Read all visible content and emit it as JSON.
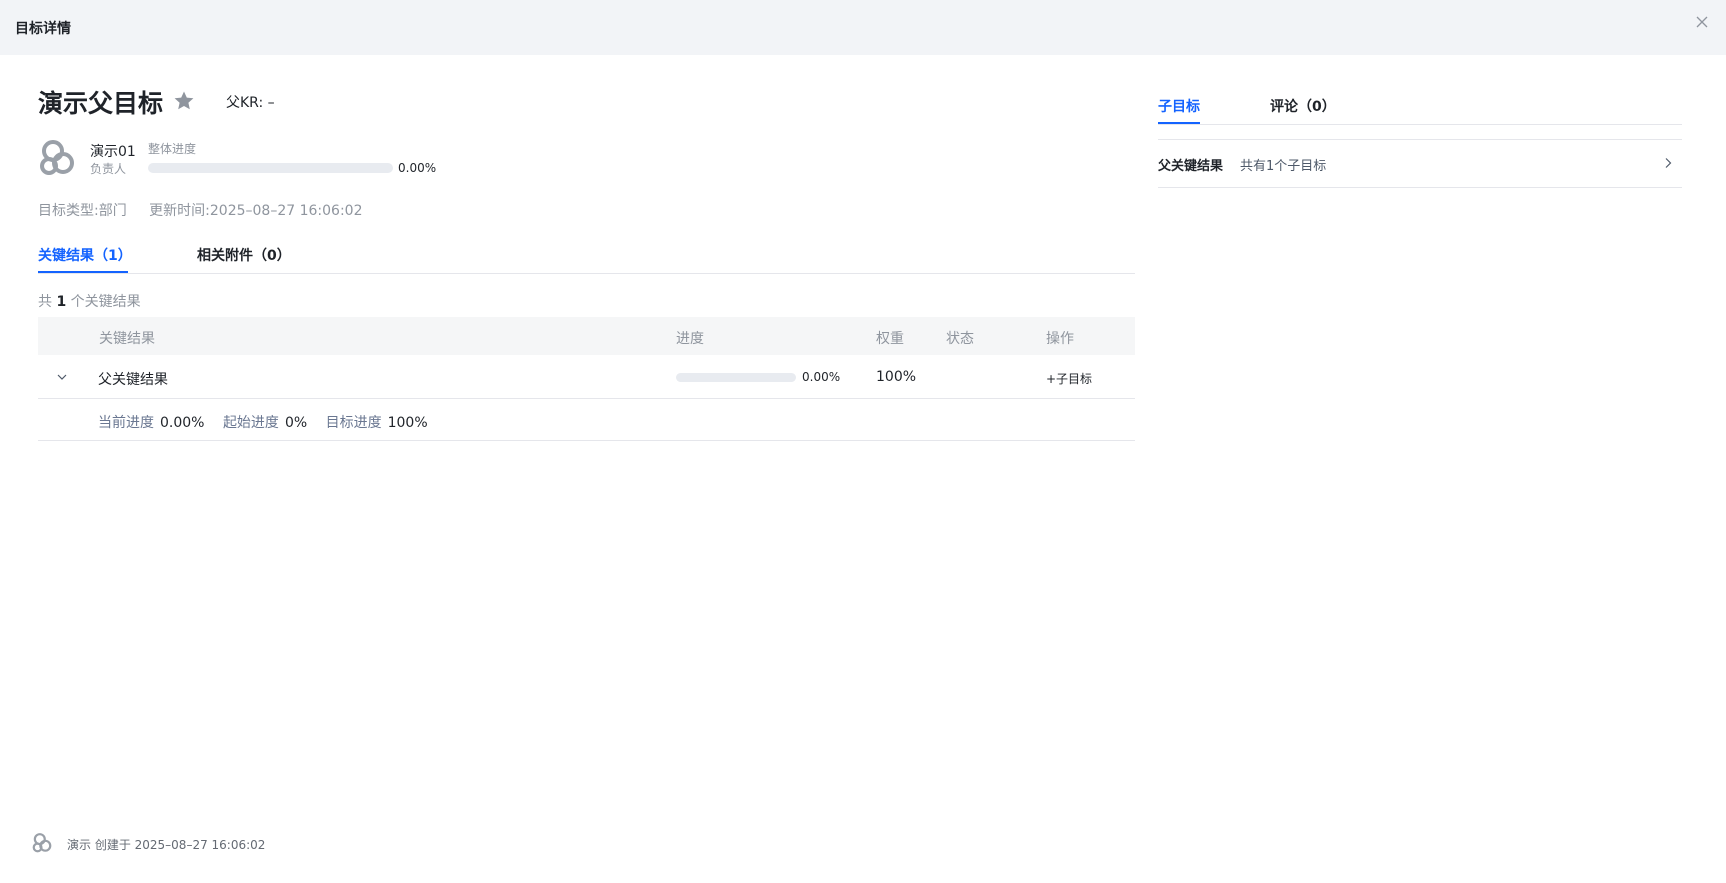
{
  "header": {
    "title": "目标详情",
    "close_icon": "close-icon"
  },
  "objective": {
    "title": "演示父目标",
    "star_icon": "star-icon",
    "parent_kr_label": "父KR:",
    "parent_kr_value": "–",
    "owner": {
      "name": "演示01",
      "role": "负责人",
      "avatar_icon": "user-avatar-icon"
    },
    "overall_progress": {
      "label": "整体进度",
      "value": 0.0,
      "display": "0.00%"
    },
    "type_label": "目标类型:",
    "type_value": "部门",
    "updated_label": "更新时间:",
    "updated_value": "2025–08–27 16:06:02"
  },
  "tabs": {
    "kr": "关键结果（1）",
    "attachments": "相关附件（0）"
  },
  "kr_summary": {
    "prefix": "共",
    "count": "1",
    "suffix": "个关键结果"
  },
  "table": {
    "headers": {
      "kr": "关键结果",
      "progress": "进度",
      "weight": "权重",
      "status": "状态",
      "action": "操作"
    },
    "rows": [
      {
        "name": "父关键结果",
        "progress_value": 0.0,
        "progress_display": "0.00%",
        "weight": "100%",
        "status": "",
        "action": "+子目标",
        "detail": {
          "current_label": "当前进度",
          "current_value": "0.00%",
          "start_label": "起始进度",
          "start_value": "0%",
          "target_label": "目标进度",
          "target_value": "100%"
        }
      }
    ]
  },
  "right_panel": {
    "tabs": {
      "sub_objectives": "子目标",
      "comments": "评论（0）"
    },
    "list": [
      {
        "name": "父关键结果",
        "count_text": "共有1个子目标"
      }
    ]
  },
  "footer": {
    "text": "演示 创建于 2025–08–27 16:06:02"
  },
  "colors": {
    "accent": "#1463ff",
    "header_bg": "#f2f4f7",
    "muted": "#8f959e",
    "table_head_bg": "#f5f6f7"
  }
}
